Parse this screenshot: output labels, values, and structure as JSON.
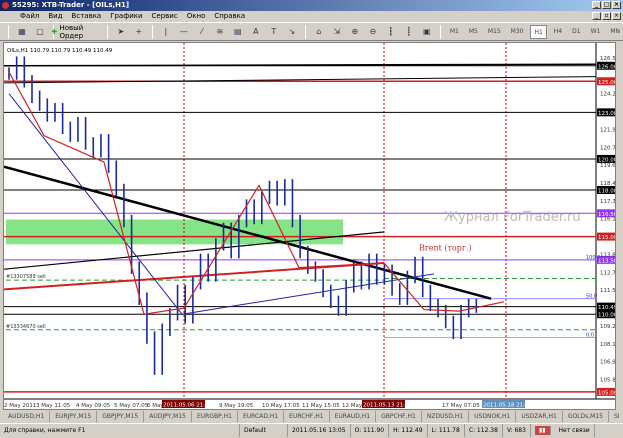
{
  "window": {
    "title": "55295: XTB-Trader - [OILs,H1]"
  },
  "menu": [
    "Файл",
    "Вид",
    "Вставка",
    "Графики",
    "Сервис",
    "Окно",
    "Справка"
  ],
  "toolbar": {
    "new_order": "Новый Ордер",
    "timeframes": [
      "M1",
      "M5",
      "M15",
      "M30",
      "H1",
      "H4",
      "D1",
      "W1",
      "MN"
    ],
    "active_timeframe": "H1"
  },
  "chart": {
    "info": "OILs,H1  110.79 110.79 110.49 110.49",
    "price_ticks": [
      "126.50",
      "124.20",
      "121.90",
      "120.75",
      "119.60",
      "118.45",
      "117.30",
      "116.15",
      "113.85",
      "112.70",
      "111.55",
      "109.25",
      "108.10",
      "106.95",
      "105.80"
    ],
    "levels": [
      {
        "price": 126.0,
        "label": "126.00",
        "color": "#000000"
      },
      {
        "price": 125.0,
        "label": "125.00",
        "color": "#d02020"
      },
      {
        "price": 123.0,
        "label": "123.00",
        "color": "#000000"
      },
      {
        "price": 120.0,
        "label": "120.00",
        "color": "#000000"
      },
      {
        "price": 118.0,
        "label": "118.00",
        "color": "#000000"
      },
      {
        "price": 116.5,
        "label": "116.50",
        "color": "#9933ff"
      },
      {
        "price": 115.0,
        "label": "115.00",
        "color": "#d02020"
      },
      {
        "price": 113.5,
        "label": "113.50",
        "color": "#9933ff"
      },
      {
        "price": 110.49,
        "label": "110.49",
        "color": "#000000"
      },
      {
        "price": 110.0,
        "label": "110.00",
        "color": "#000000"
      },
      {
        "price": 105.0,
        "label": "105.00",
        "color": "#d02020"
      }
    ],
    "fib_labels": [
      "100.0",
      "50.0",
      "0.0"
    ],
    "order_labels": [
      "#13307589 sell",
      "#13334670 sell"
    ],
    "annotation": "Brent (торг.)",
    "watermark": "Журнал ForTrader.ru",
    "closes": [
      125.5,
      126.2,
      125.0,
      124.0,
      123.5,
      122.8,
      123.2,
      122.0,
      121.5,
      122.3,
      121.0,
      120.5,
      121.2,
      119.5,
      118.0,
      116.0,
      113.0,
      111.0,
      108.5,
      106.5,
      109.0,
      110.0,
      111.5,
      109.8,
      112.0,
      113.5,
      112.5,
      114.5,
      115.5,
      114.0,
      116.0,
      117.0,
      116.2,
      117.5,
      118.2,
      117.4,
      118.3,
      116.0,
      114.0,
      113.0,
      112.5,
      111.5,
      110.8,
      110.3,
      111.8,
      113.0,
      112.0,
      113.5,
      112.3,
      112.8,
      111.6,
      111.0,
      112.4,
      113.3,
      111.5,
      110.6,
      110.2,
      109.5,
      108.8,
      110.2,
      110.6,
      110.49
    ],
    "time_labels": [
      "2 May 2011",
      "3 May 11:05",
      "4 May 09:05",
      "5 May 07:05",
      "6 May",
      "9 May 19:05",
      "10 May 17:05",
      "11 May 15:05",
      "12 May 13:05",
      "17 May 07:05",
      "18 Ma"
    ],
    "time_markers": [
      {
        "label": "2011.05.06 21:05",
        "color": "#800000"
      },
      {
        "label": "2011.05.13 21:05",
        "color": "#800000"
      },
      {
        "label": "2011.05.18 21:05",
        "color": "#6090c0"
      }
    ]
  },
  "tabs": [
    "AUDUSD,H1",
    "EURJPY,M15",
    "GBPJPY,M15",
    "AUDJPY,M15",
    "EURGBP,H1",
    "EURCAD,H1",
    "EURCHF,H1",
    "EURAUD,H1",
    "GBPCHF,H1",
    "NZDUSD,H1",
    "USDNOK,H1",
    "USDZAR,H1",
    "GOLDs,M15",
    "SI"
  ],
  "status": {
    "help": "Для справки, нажмите F1",
    "profile": "Default",
    "datetime": "2011.05.16 13:05",
    "open": "O: 111.90",
    "high": "H: 112.49",
    "low": "L: 111.78",
    "close": "C: 112.38",
    "volume": "V: 683",
    "connection": "Нет связи"
  }
}
